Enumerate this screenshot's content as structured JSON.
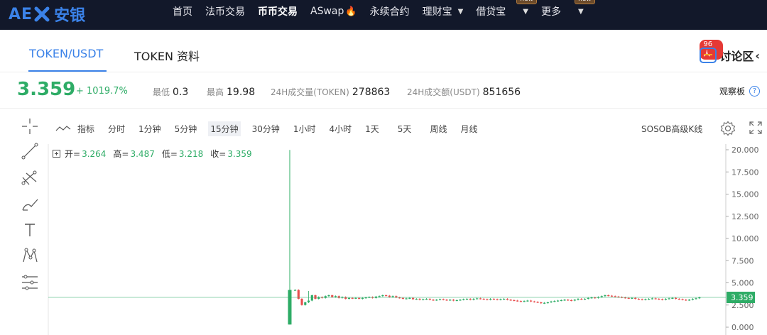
{
  "brand": {
    "mark": "AE",
    "name": "安银"
  },
  "nav": {
    "items": [
      {
        "label": "首页"
      },
      {
        "label": "法币交易"
      },
      {
        "label": "币币交易",
        "active": true
      },
      {
        "label": "ASwap"
      },
      {
        "label": "永续合约"
      },
      {
        "label": "理财宝"
      },
      {
        "label": "借贷宝",
        "badge": "new"
      },
      {
        "label": "更多",
        "badge": "new"
      }
    ]
  },
  "tabs": {
    "pair": "TOKEN/USDT",
    "info": "TOKEN 资料"
  },
  "discuss": {
    "label": "讨论区",
    "count": "96人"
  },
  "ticker": {
    "price": "3.359",
    "change": "+ 1019.7%",
    "low_label": "最低",
    "low": "0.3",
    "high_label": "最高",
    "high": "19.98",
    "vol_label": "24H成交量(TOKEN)",
    "vol": "278863",
    "amt_label": "24H成交额(USDT)",
    "amt": "851656",
    "observe": "观察板",
    "help": "?"
  },
  "chart_toolbar": {
    "indicator": "指标",
    "intervals": [
      "分时",
      "1分钟",
      "5分钟",
      "15分钟",
      "30分钟",
      "1小时",
      "4小时",
      "1天",
      "5天",
      "周线",
      "月线"
    ],
    "active_interval": "15分钟",
    "sosob": "SOSOB高级K线"
  },
  "ohlc": {
    "open_label": "开=",
    "open": "3.264",
    "high_label": "高=",
    "high": "3.487",
    "low_label": "低=",
    "low": "3.218",
    "close_label": "收=",
    "close": "3.359"
  },
  "colors": {
    "up": "#2eac66",
    "down": "#e84e4e",
    "accent": "#3b82e8",
    "topbar": "#12182a"
  },
  "chart_data": {
    "type": "candlestick",
    "title": "",
    "y_ticks": [
      "20.000",
      "17.500",
      "15.000",
      "12.500",
      "10.000",
      "7.500",
      "5.000",
      "2.500",
      "0.000"
    ],
    "ylim": [
      0,
      20
    ],
    "last_price": "3.359",
    "spike": {
      "open": 0.3,
      "high": 19.98,
      "low": 0.3,
      "close": 4.2
    },
    "closes": [
      4.2,
      3.2,
      2.5,
      2.8,
      3.0,
      3.6,
      3.2,
      3.4,
      3.3,
      3.5,
      3.6,
      3.4,
      3.5,
      3.3,
      3.4,
      3.2,
      3.3,
      3.25,
      3.3,
      3.2,
      3.3,
      3.35,
      3.4,
      3.3,
      3.45,
      3.5,
      3.6,
      3.55,
      3.4,
      3.5,
      3.35,
      3.3,
      3.2,
      3.25,
      3.3,
      3.15,
      3.2,
      3.1,
      3.15,
      3.2,
      3.1,
      3.05,
      3.1,
      3.15,
      3.1,
      3.05,
      3.1,
      3.0,
      3.05,
      3.1,
      3.15,
      3.2,
      3.1,
      3.2,
      3.25,
      3.2,
      3.15,
      3.1,
      3.2,
      3.15,
      3.1,
      3.15,
      3.2,
      3.1,
      3.05,
      3.0,
      2.95,
      2.9,
      2.95,
      3.0,
      2.9,
      2.85,
      2.8,
      2.7,
      2.75,
      2.8,
      2.9,
      2.95,
      3.0,
      3.05,
      3.1,
      3.05,
      3.0,
      3.1,
      3.2,
      3.15,
      3.2,
      3.3,
      3.35,
      3.3,
      3.4,
      3.5,
      3.6,
      3.55,
      3.5,
      3.45,
      3.4,
      3.35,
      3.3,
      3.25,
      3.3,
      3.2,
      3.15,
      3.1,
      3.15,
      3.2,
      3.25,
      3.2,
      3.15,
      3.1,
      3.2,
      3.25,
      3.3,
      3.2,
      3.15,
      3.1,
      3.05,
      3.1,
      3.2,
      3.26,
      3.36
    ]
  }
}
